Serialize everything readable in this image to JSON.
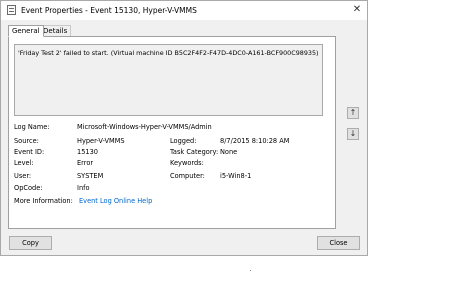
{
  "window": {
    "title": "Event Properties - Event 15130, Hyper-V-VMMS",
    "close_glyph": "✕"
  },
  "tabs": [
    {
      "label": "General",
      "active": true
    },
    {
      "label": "Details",
      "active": false
    }
  ],
  "description": "'Friday Test 2' failed to start. (Virtual machine ID B5C2F4F2-F47D-4DC0-A161-BCF900C98935)",
  "nav": {
    "up_glyph": "↑",
    "down_glyph": "↓"
  },
  "fields": {
    "log_name": {
      "label": "Log Name:",
      "value": "Microsoft-Windows-Hyper-V-VMMS/Admin"
    },
    "source": {
      "label": "Source:",
      "value": "Hyper-V-VMMS"
    },
    "logged": {
      "label": "Logged:",
      "value": "8/7/2015 8:10:28 AM"
    },
    "event_id": {
      "label": "Event ID:",
      "value": "15130"
    },
    "task_category": {
      "label": "Task Category:",
      "value": "None"
    },
    "level": {
      "label": "Level:",
      "value": "Error"
    },
    "keywords": {
      "label": "Keywords:",
      "value": ""
    },
    "user": {
      "label": "User:",
      "value": "SYSTEM"
    },
    "computer": {
      "label": "Computer:",
      "value": "i5-Win8-1"
    },
    "opcode": {
      "label": "OpCode:",
      "value": "Info"
    },
    "more_info": {
      "label": "More Information:",
      "value": "Event Log Online Help"
    }
  },
  "buttons": {
    "copy": "Copy",
    "close": "Close"
  },
  "colors": {
    "link": "#0066cc",
    "dialog_bg": "#f0f0f0"
  }
}
